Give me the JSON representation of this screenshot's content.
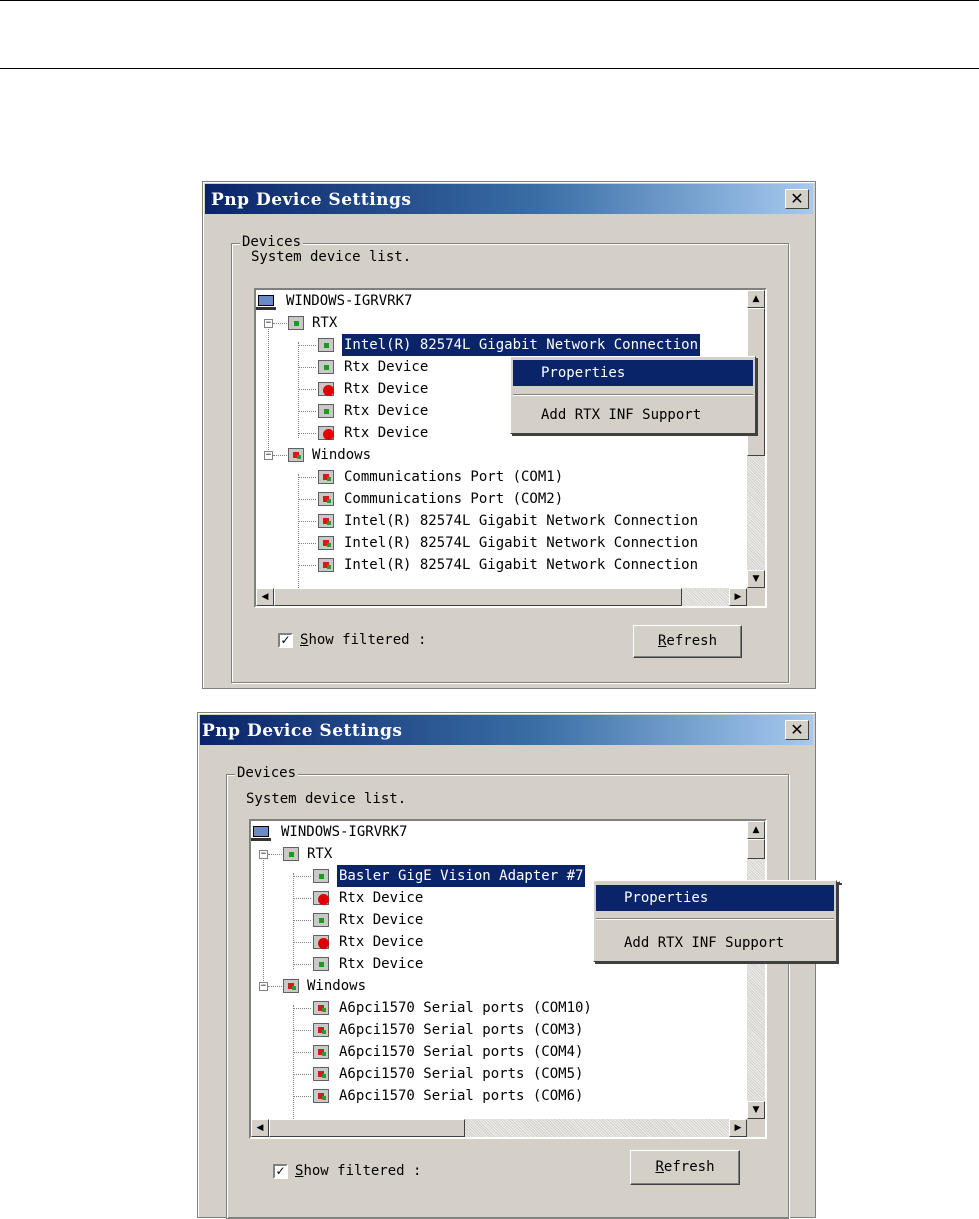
{
  "dialogs": [
    {
      "title": "Pnp Device Settings",
      "close_glyph": "✕",
      "group_label": "Devices",
      "list_label": "System device list.",
      "tree": {
        "root": "WINDOWS-IGRVRK7",
        "rtx_label": "RTX",
        "rtx_children": [
          {
            "label": "Intel(R) 82574L Gigabit Network Connection",
            "icon": "device-icon",
            "selected": true
          },
          {
            "label": "Rtx Device",
            "icon": "device-icon"
          },
          {
            "label": "Rtx Device",
            "icon": "device-warning-icon"
          },
          {
            "label": "Rtx Device",
            "icon": "device-icon"
          },
          {
            "label": "Rtx Device",
            "icon": "device-warning-icon"
          }
        ],
        "windows_label": "Windows",
        "windows_children": [
          {
            "label": "Communications Port (COM1)"
          },
          {
            "label": "Communications Port (COM2)"
          },
          {
            "label": "Intel(R) 82574L Gigabit Network Connection"
          },
          {
            "label": "Intel(R) 82574L Gigabit Network Connection"
          },
          {
            "label": "Intel(R) 82574L Gigabit Network Connection"
          }
        ]
      },
      "context_menu": {
        "items": [
          "Properties",
          "Add RTX INF Support"
        ],
        "highlighted": "Properties"
      },
      "checkbox": {
        "label_prefix": "S",
        "label_rest": "how filtered :",
        "checked": true,
        "mark": "✓"
      },
      "refresh": {
        "underlined": "R",
        "rest": "efresh"
      }
    },
    {
      "title": "Pnp Device Settings",
      "close_glyph": "✕",
      "group_label": "Devices",
      "list_label": "System device list.",
      "tree": {
        "root": "WINDOWS-IGRVRK7",
        "rtx_label": "RTX",
        "rtx_children": [
          {
            "label": "Basler GigE Vision Adapter #7",
            "icon": "device-icon",
            "selected": true
          },
          {
            "label": "Rtx Device",
            "icon": "device-warning-icon"
          },
          {
            "label": "Rtx Device",
            "icon": "device-icon"
          },
          {
            "label": "Rtx Device",
            "icon": "device-warning-icon"
          },
          {
            "label": "Rtx Device",
            "icon": "device-icon"
          }
        ],
        "windows_label": "Windows",
        "windows_children": [
          {
            "label": "A6pci1570 Serial ports (COM10)"
          },
          {
            "label": "A6pci1570 Serial ports (COM3)"
          },
          {
            "label": "A6pci1570 Serial ports (COM4)"
          },
          {
            "label": "A6pci1570 Serial ports (COM5)"
          },
          {
            "label": "A6pci1570 Serial ports (COM6)"
          }
        ]
      },
      "context_menu": {
        "items": [
          "Properties",
          "Add RTX INF Support"
        ],
        "highlighted": "Properties"
      },
      "checkbox": {
        "label_prefix": "S",
        "label_rest": "how filtered :",
        "checked": true,
        "mark": "✓"
      },
      "refresh": {
        "underlined": "R",
        "rest": "efresh"
      }
    }
  ],
  "scroll_glyphs": {
    "up": "▲",
    "down": "▼",
    "left": "◀",
    "right": "▶"
  },
  "expander_glyph": "−"
}
